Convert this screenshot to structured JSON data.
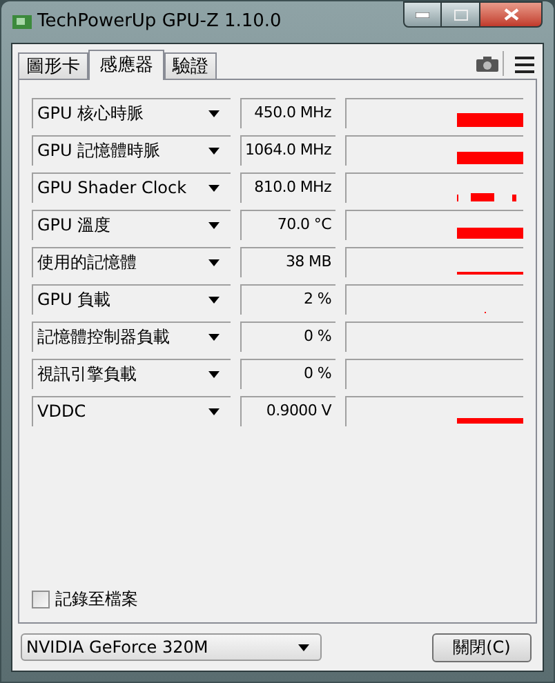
{
  "window": {
    "title": "TechPowerUp GPU-Z 1.10.0"
  },
  "tabs": [
    {
      "label": "圖形卡",
      "selected": false
    },
    {
      "label": "感應器",
      "selected": true
    },
    {
      "label": "驗證",
      "selected": false
    }
  ],
  "sensors": [
    {
      "name": "GPU 核心時脈",
      "reading": "450.0 MHz"
    },
    {
      "name": "GPU 記憶體時脈",
      "reading": "1064.0 MHz"
    },
    {
      "name": "GPU Shader Clock",
      "reading": "810.0 MHz"
    },
    {
      "name": "GPU 溫度",
      "reading": "70.0 °C"
    },
    {
      "name": "使用的記憶體",
      "reading": "38 MB"
    },
    {
      "name": "GPU 負載",
      "reading": "2 %"
    },
    {
      "name": "記憶體控制器負載",
      "reading": "0 %"
    },
    {
      "name": "視訊引擎負載",
      "reading": "0 %"
    },
    {
      "name": "VDDC",
      "reading": "0.9000 V"
    }
  ],
  "log_to_file": {
    "label": "記錄至檔案",
    "checked": false
  },
  "gpu_select": {
    "value": "NVIDIA GeForce 320M"
  },
  "close_button": {
    "label": "關閉(C)"
  }
}
